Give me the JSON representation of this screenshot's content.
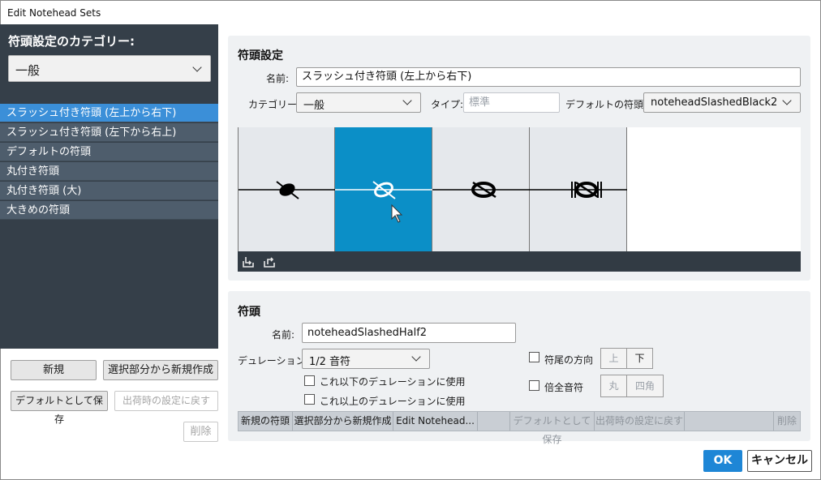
{
  "window": {
    "title": "Edit Notehead Sets"
  },
  "left": {
    "category_label": "符頭設定のカテゴリー:",
    "category_value": "一般",
    "items": [
      "スラッシュ付き符頭 (左上から右下)",
      "スラッシュ付き符頭 (左下から右上)",
      "デフォルトの符頭",
      "丸付き符頭",
      "丸付き符頭 (大)",
      "大きめの符頭"
    ],
    "selected_index": 0,
    "buttons": {
      "new": "新規",
      "new_from_selection": "選択部分から新規作成",
      "save_default": "デフォルトとして保存",
      "revert_factory": "出荷時の設定に戻す",
      "delete": "削除"
    }
  },
  "set_settings": {
    "title": "符頭設定",
    "name_label": "名前:",
    "name_value": "スラッシュ付き符頭 (左上から右下)",
    "category_label": "カテゴリー:",
    "category_value": "一般",
    "type_label": "タイプ:",
    "type_placeholder": "標準",
    "default_label": "デフォルトの符頭:",
    "default_value": "noteheadSlashedBlack2",
    "selected_cell": 1
  },
  "notehead": {
    "title": "符頭",
    "name_label": "名前:",
    "name_value": "noteheadSlashedHalf2",
    "duration_label": "デュレーション:",
    "duration_value": "1/2 音符",
    "use_below": "これ以下のデュレーションに使用",
    "use_above": "これ以上のデュレーションに使用",
    "stem_direction_label": "符尾の方向",
    "stem_up": "上",
    "stem_down": "下",
    "double_whole_label": "倍全音符",
    "round": "丸",
    "square": "四角"
  },
  "toolbar": {
    "new_notehead": "新規の符頭",
    "new_from_selection": "選択部分から新規作成",
    "edit_notehead": "Edit Notehead...",
    "save_default": "デフォルトとして保存",
    "revert_factory": "出荷時の設定に戻す",
    "delete": "削除"
  },
  "dialog": {
    "ok": "OK",
    "cancel": "キャンセル"
  },
  "colors": {
    "accent": "#1e86d6",
    "selected_cell": "#0b8fc7",
    "sidebar": "#353f49",
    "list_item": "#4e5d6c",
    "list_selected": "#3b8fd8"
  }
}
